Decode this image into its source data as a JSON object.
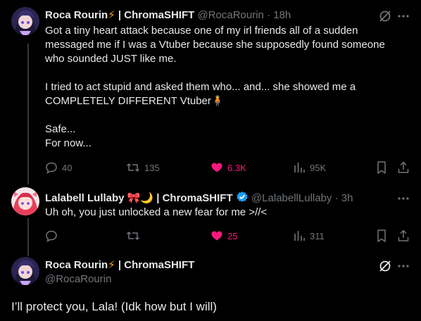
{
  "tweets": [
    {
      "author": "Roca Rourin",
      "emoji": "⚡",
      "org": "| ChromaSHIFT",
      "handle": "@RocaRourin",
      "time": "· 18h",
      "text": "Got a tiny heart attack because one of my irl friends all of a sudden messaged me if I was a Vtuber because she supposedly found someone who sounded JUST like me.\n\nI tried to act stupid and asked them who... and... she showed me a COMPLETELY DIFFERENT Vtuber🧍\n\nSafe...\nFor now...",
      "replies": "40",
      "retweets": "135",
      "likes": "6.3K",
      "views": "95K"
    },
    {
      "author": "Lalabell Lullaby",
      "emoji": "🎀🌙",
      "org": "| ChromaSHIFT",
      "handle": "@LalabellLullaby",
      "time": "· 3h",
      "text": "Uh oh, you just unlocked a new fear for me >//<",
      "replies": "",
      "retweets": "",
      "likes": "25",
      "views": "311"
    },
    {
      "author": "Roca Rourin",
      "emoji": "⚡",
      "org": "| ChromaSHIFT",
      "handle": "@RocaRourin",
      "text": "I’ll protect you, Lala! (Idk how but I will)"
    }
  ],
  "colors": {
    "background": "#000000",
    "text": "#e7e9ea",
    "muted": "#71767b",
    "like_active": "#f91880",
    "verified": "#1d9bf0"
  }
}
